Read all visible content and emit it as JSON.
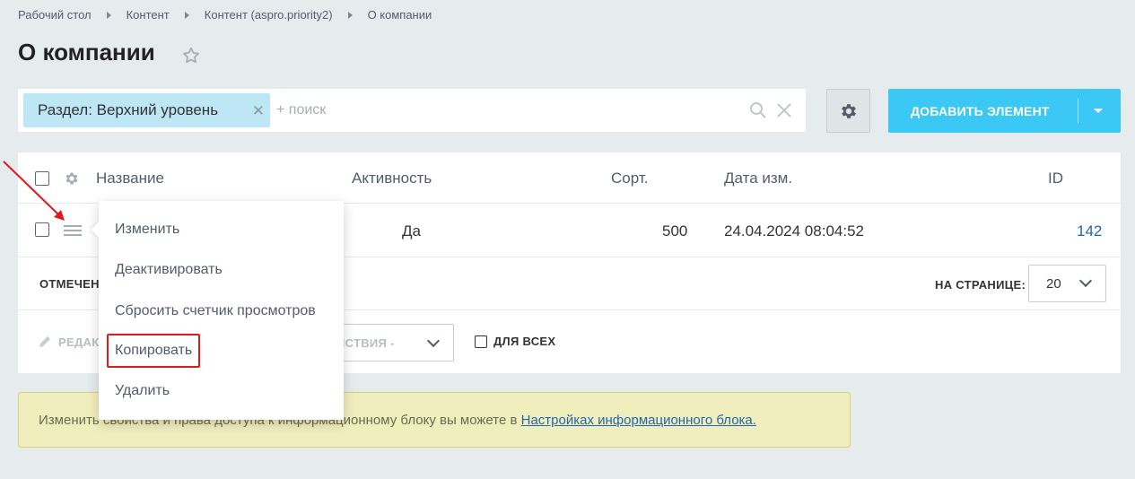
{
  "breadcrumb": [
    "Рабочий стол",
    "Контент",
    "Контент (aspro.priority2)",
    "О компании"
  ],
  "page_title": "О компании",
  "filter": {
    "chip_label": "Раздел: Верхний уровень",
    "search_placeholder": "+ поиск"
  },
  "add_button_label": "ДОБАВИТЬ ЭЛЕМЕНТ",
  "grid": {
    "columns": [
      "Название",
      "Активность",
      "Сорт.",
      "Дата изм.",
      "ID"
    ],
    "row": {
      "active": "Да",
      "sort": "500",
      "modified": "24.04.2024 08:04:52",
      "id": "142"
    },
    "marked_label": "ОТМЕЧЕН",
    "per_page_label": "НА СТРАНИЦЕ:",
    "per_page_value": "20",
    "edit_label": "РЕДАК",
    "actions_placeholder": "ЕЙСТВИЯ -",
    "for_all_label": "ДЛЯ ВСЕХ"
  },
  "context_menu": {
    "items": [
      "Изменить",
      "Деактивировать",
      "Сбросить счетчик просмотров",
      "Копировать",
      "Удалить"
    ],
    "highlighted": "Копировать"
  },
  "notice": {
    "text": "Изменить свойства и права доступа к информационному блоку вы можете в ",
    "link": "Настройках информационного блока."
  },
  "colors": {
    "accent": "#3bc8f5",
    "chip": "#bde7f5",
    "notice_bg": "#f1eebd",
    "highlight": "#e01a1a",
    "link": "#2067b0"
  }
}
